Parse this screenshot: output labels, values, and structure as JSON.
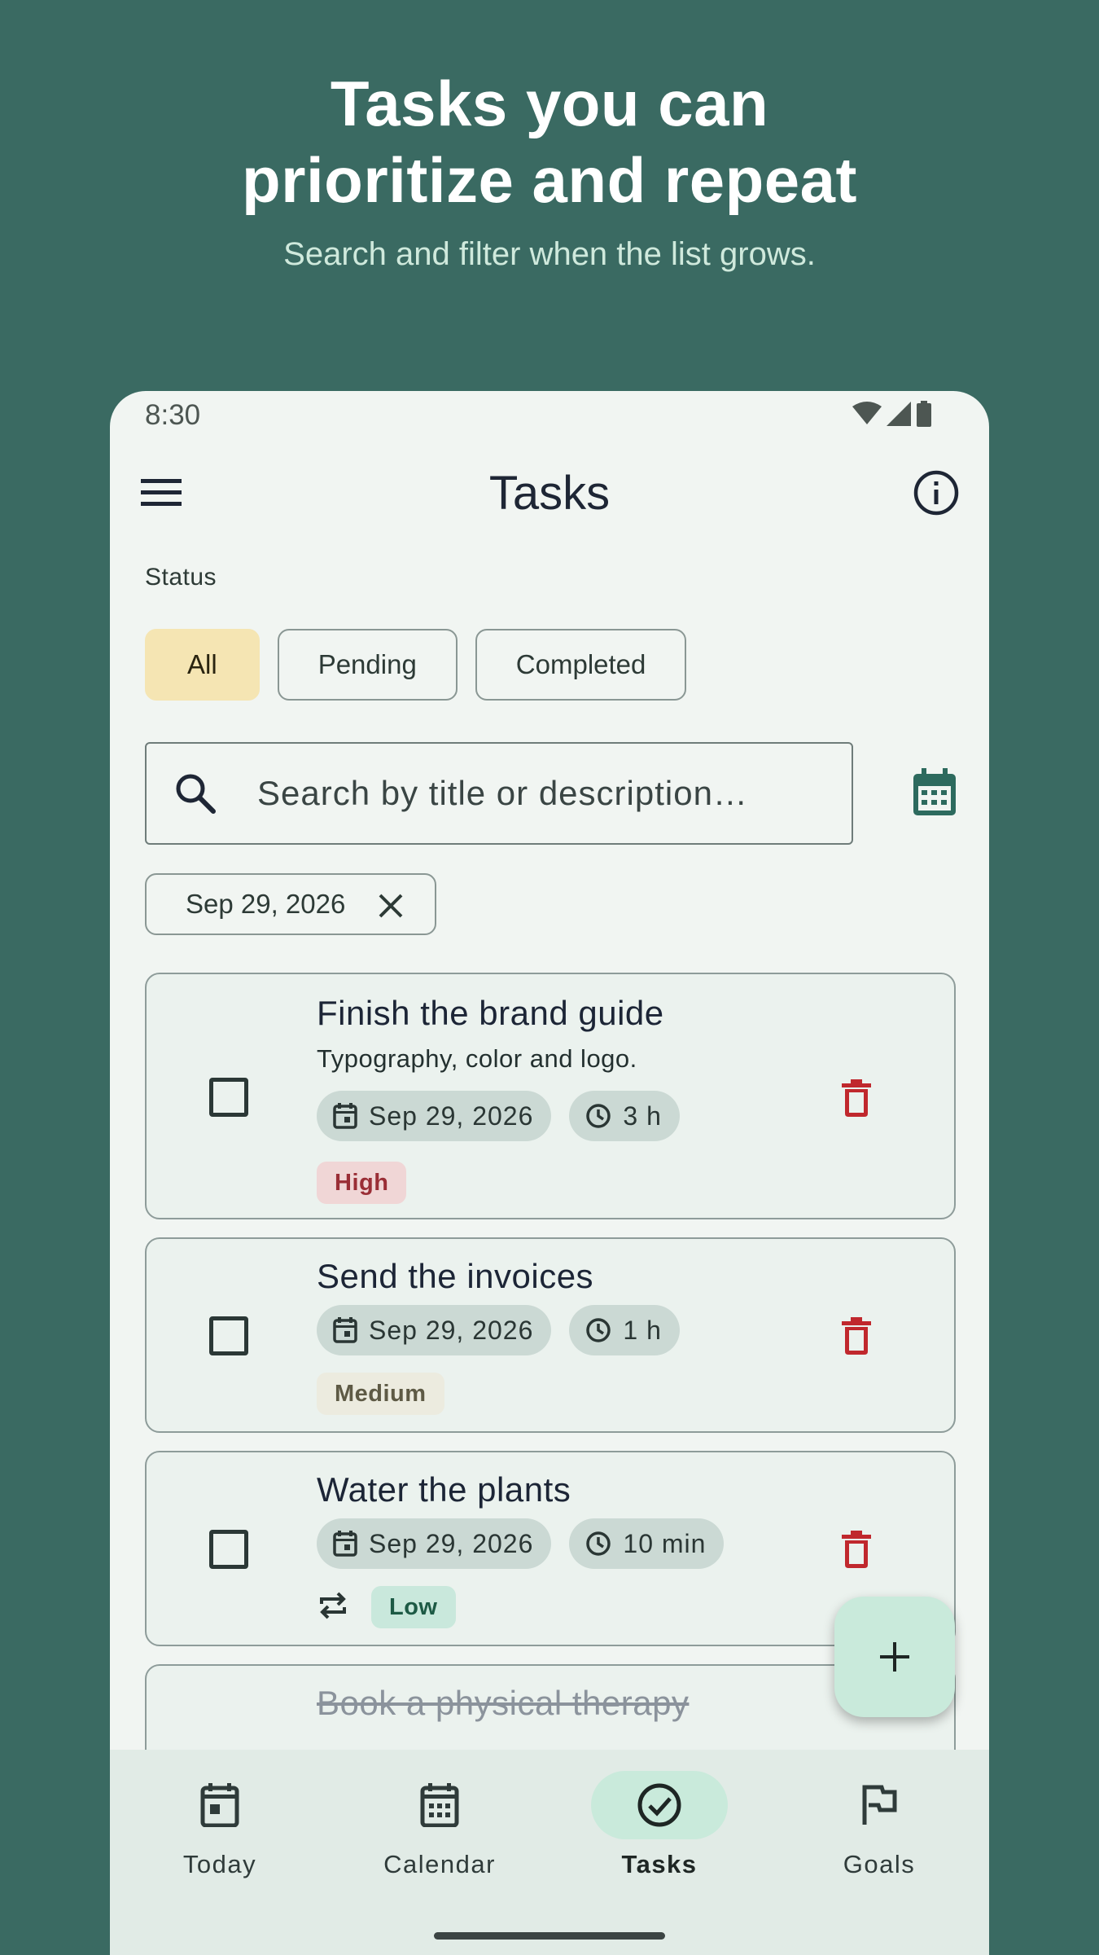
{
  "hero": {
    "title_line1": "Tasks you can",
    "title_line2": "prioritize and repeat",
    "subtitle": "Search and filter when the list grows."
  },
  "status_bar": {
    "time": "8:30"
  },
  "app_bar": {
    "title": "Tasks",
    "menu_icon": "menu-icon",
    "info_icon": "info-icon"
  },
  "filters": {
    "label": "Status",
    "chips": [
      {
        "label": "All",
        "selected": true
      },
      {
        "label": "Pending",
        "selected": false
      },
      {
        "label": "Completed",
        "selected": false
      }
    ]
  },
  "search": {
    "placeholder": "Search by title or description…",
    "icon": "search-icon"
  },
  "date_filter": {
    "label": "Sep 29, 2026"
  },
  "tasks": [
    {
      "title": "Finish the brand guide",
      "description": "Typography, color and logo.",
      "date": "Sep 29, 2026",
      "duration": "3 h",
      "priority": "High",
      "repeat": false,
      "done": false
    },
    {
      "title": "Send the invoices",
      "date": "Sep 29, 2026",
      "duration": "1 h",
      "priority": "Medium",
      "repeat": false,
      "done": false
    },
    {
      "title": "Water the plants",
      "date": "Sep 29, 2026",
      "duration": "10 min",
      "priority": "Low",
      "repeat": true,
      "done": false
    },
    {
      "title": "Book a physical therapy",
      "done": true
    }
  ],
  "bottom_nav": [
    {
      "label": "Today",
      "icon": "today-icon",
      "active": false
    },
    {
      "label": "Calendar",
      "icon": "calendar-icon",
      "active": false
    },
    {
      "label": "Tasks",
      "icon": "check-circle-icon",
      "active": true
    },
    {
      "label": "Goals",
      "icon": "flag-icon",
      "active": false
    }
  ],
  "colors": {
    "background": "#3a6a62",
    "surface": "#f1f5f2",
    "selected_chip": "#f5e5b3",
    "delete": "#c0282d",
    "fab": "#c9eadb"
  }
}
